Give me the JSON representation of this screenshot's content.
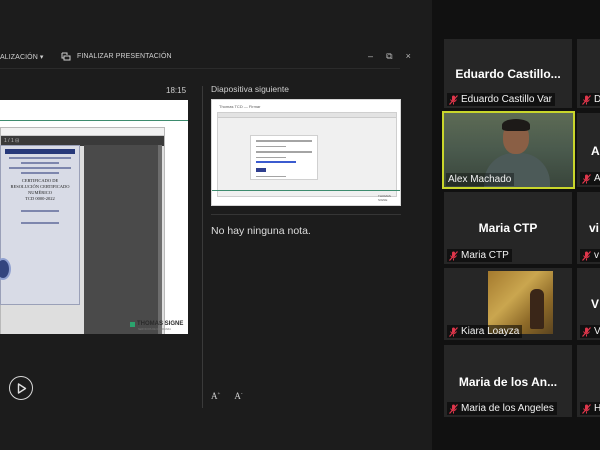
{
  "toolbar": {
    "left_text": "ALIZACIÓN ▾",
    "end_presentation": "FINALIZAR PRESENTACIÓN",
    "window_controls": [
      "–",
      "⧉",
      "×"
    ]
  },
  "presenter": {
    "timer": "18:15",
    "next_slide_label": "Diapositiva siguiente",
    "notes_text": "No hay ninguna nota.",
    "font_increase": "A",
    "font_decrease": "A",
    "current_slide": {
      "doc_title": "CERTIFICADO DE\nRESOLUCIÓN CERTIFICADO NUMÉRICO\nTCD 0000-2022",
      "brand": "THOMAS SIGNE",
      "brand_sub": "SERVICIOS DE CONFIANZA",
      "nav_text": "1 / 1 ⊟"
    },
    "next_slide": {
      "tab_title": "Thomas TCD — Firmar",
      "brand": "THOMAS SIGNE"
    }
  },
  "participants": [
    {
      "display": "Eduardo  Castillo...",
      "name": "Eduardo Castillo Var",
      "muted": true,
      "video": false
    },
    {
      "display": "",
      "name": "D",
      "muted": true,
      "video": false
    },
    {
      "display": "",
      "name": "Alex Machado",
      "muted": false,
      "video": true,
      "active": true
    },
    {
      "display": "A",
      "name": "A",
      "muted": true,
      "video": false
    },
    {
      "display": "Maria CTP",
      "name": "Maria CTP",
      "muted": true,
      "video": false
    },
    {
      "display": "vi",
      "name": "v",
      "muted": true,
      "video": false
    },
    {
      "display": "",
      "name": "Kiara Loayza",
      "muted": true,
      "video": false,
      "thumbnail": true
    },
    {
      "display": "V",
      "name": "V",
      "muted": true,
      "video": false
    },
    {
      "display": "Maria de los An...",
      "name": "Maria de los Angeles",
      "muted": true,
      "video": false
    },
    {
      "display": "",
      "name": "H",
      "muted": true,
      "video": false
    }
  ],
  "colors": {
    "background": "#1b1b1b",
    "tile": "#262626",
    "active_speaker_border": "#c9d62b",
    "muted_icon": "#e0364b",
    "slide_accent": "#2ba36e"
  }
}
